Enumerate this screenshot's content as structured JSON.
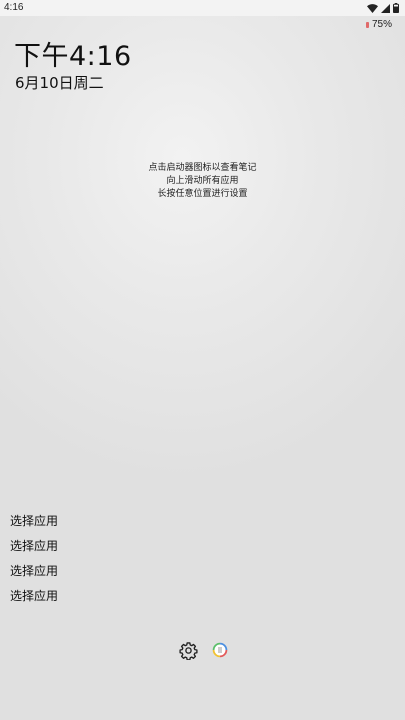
{
  "status_bar": {
    "time": "4:16",
    "battery_percent": "75%",
    "icons": [
      "wifi-icon",
      "cell-signal-icon",
      "battery-icon"
    ]
  },
  "clock": {
    "time": "下午4:16",
    "date": "6月10日周二"
  },
  "hints": [
    "点击启动器图标以查看笔记",
    "向上滑动所有应用",
    "长按任意位置进行设置"
  ],
  "app_slots": [
    {
      "label": "选择应用"
    },
    {
      "label": "选择应用"
    },
    {
      "label": "选择应用"
    },
    {
      "label": "选择应用"
    }
  ],
  "dock": {
    "icons": [
      "settings-gear-icon",
      "launcher-app-icon"
    ]
  },
  "colors": {
    "battery_indicator": "#e06a6a",
    "text": "#111111"
  }
}
